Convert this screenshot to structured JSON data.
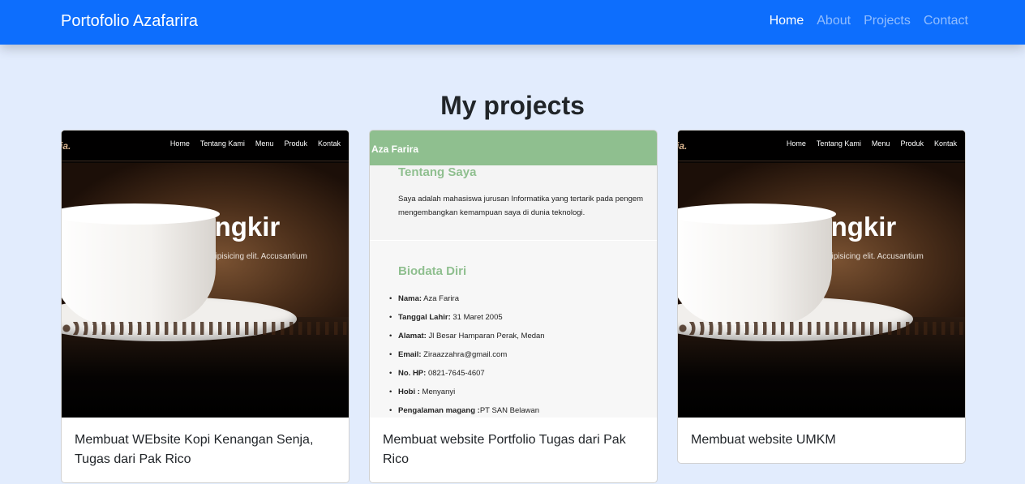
{
  "navbar": {
    "brand": "Portofolio Azafarira",
    "links": [
      "Home",
      "About",
      "Projects",
      "Contact"
    ],
    "active": "Home"
  },
  "projects": {
    "title": "My projects",
    "cards": [
      {
        "caption": "Membuat WEbsite Kopi Kenangan Senja, Tugas dari Pak Rico",
        "preview": {
          "logo": "ja.",
          "nav": [
            "Home",
            "Tentang Kami",
            "Menu",
            "Produk",
            "Kontak"
          ],
          "hero": "Ati   i Secangkir",
          "sub": "sectetur adipisicing elit. Accusantium"
        }
      },
      {
        "caption": "Membuat website Portfolio Tugas dari Pak Rico",
        "preview": {
          "brand": "Aza Farira",
          "about_title": "Tentang Saya",
          "about_text": [
            "Saya adalah mahasiswa jurusan Informatika yang tertarik pada pengem",
            "mengembangkan kemampuan saya di dunia teknologi."
          ],
          "bio_title": "Biodata Diri",
          "bio": [
            {
              "label": "Nama:",
              "value": " Aza Farira"
            },
            {
              "label": "Tanggal Lahir:",
              "value": " 31 Maret 2005"
            },
            {
              "label": "Alamat:",
              "value": " Jl Besar Hamparan Perak, Medan"
            },
            {
              "label": "Email:",
              "value": " Ziraazzahra@gmail.com"
            },
            {
              "label": "No. HP:",
              "value": " 0821-7645-4607"
            },
            {
              "label": "Hobi :",
              "value": " Menyanyi"
            },
            {
              "label": "Pengalaman magang :",
              "value": "PT SAN Belawan"
            }
          ]
        }
      },
      {
        "caption": "Membuat website UMKM",
        "preview": {
          "logo": "ja.",
          "nav": [
            "Home",
            "Tentang Kami",
            "Menu",
            "Produk",
            "Kontak"
          ],
          "hero": "Ati   i Secangkir",
          "sub": "sectetur adipisicing elit. Accusantium"
        }
      }
    ]
  }
}
